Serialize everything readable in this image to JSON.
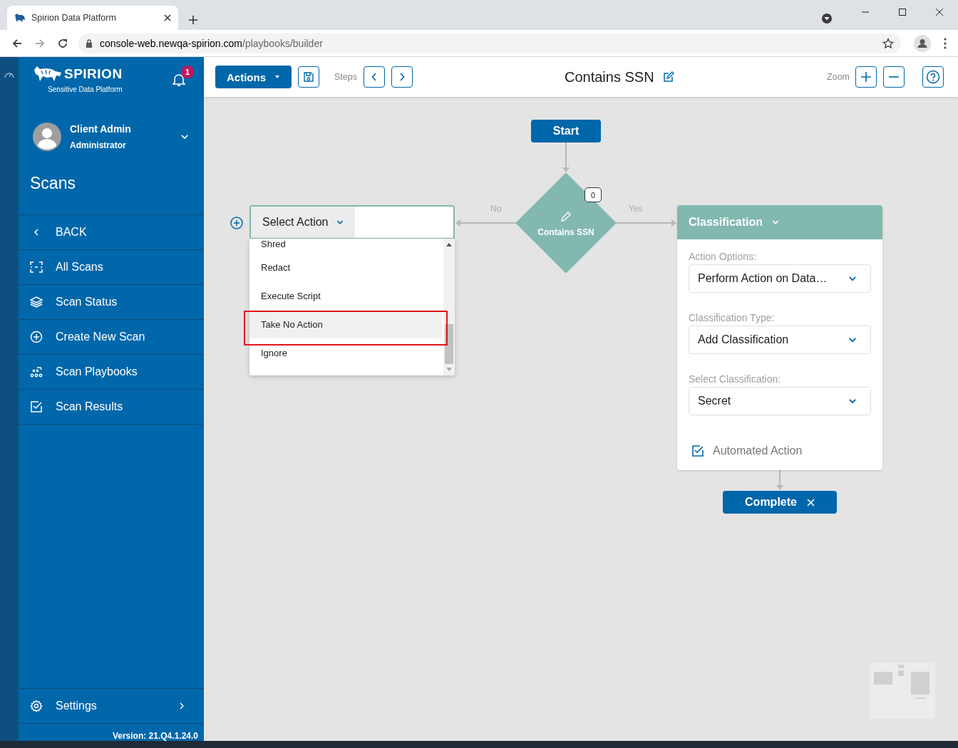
{
  "browser": {
    "tab_title": "Spirion Data Platform",
    "url_host": "console-web.newqa-spirion.com",
    "url_path": "/playbooks/builder"
  },
  "sidebar": {
    "brand": "SPIRION",
    "tagline": "Sensitive Data Platform",
    "notifications": "1",
    "user": {
      "name": "Client Admin",
      "role": "Administrator"
    },
    "section": "Scans",
    "items": [
      {
        "label": "BACK",
        "kind": "back"
      },
      {
        "label": "All Scans",
        "kind": "scan"
      },
      {
        "label": "Scan Status",
        "kind": "layers"
      },
      {
        "label": "Create New Scan",
        "kind": "plus"
      },
      {
        "label": "Scan Playbooks",
        "kind": "playbook"
      },
      {
        "label": "Scan Results",
        "kind": "check"
      }
    ],
    "settings": "Settings",
    "version": "Version: 21.Q4.1.24.0"
  },
  "toolbar": {
    "actions": "Actions",
    "steps_label": "Steps",
    "title": "Contains SSN",
    "zoom_label": "Zoom"
  },
  "canvas": {
    "start": "Start",
    "decision": {
      "label": "Contains SSN",
      "count": "0"
    },
    "no_label": "No",
    "yes_label": "Yes",
    "action_node": {
      "button": "Select Action",
      "options": [
        {
          "label": "Shred",
          "selected": false
        },
        {
          "label": "Redact",
          "selected": false
        },
        {
          "label": "Execute Script",
          "selected": false
        },
        {
          "label": "Take No Action",
          "selected": true
        },
        {
          "label": "Ignore",
          "selected": false
        }
      ]
    },
    "classification": {
      "title": "Classification",
      "fields": [
        {
          "label": "Action Options:",
          "value": "Perform Action on Data…"
        },
        {
          "label": "Classification Type:",
          "value": "Add Classification"
        },
        {
          "label": "Select Classification:",
          "value": "Secret"
        }
      ],
      "automated": {
        "label": "Automated Action",
        "checked": true
      }
    },
    "complete": "Complete"
  }
}
